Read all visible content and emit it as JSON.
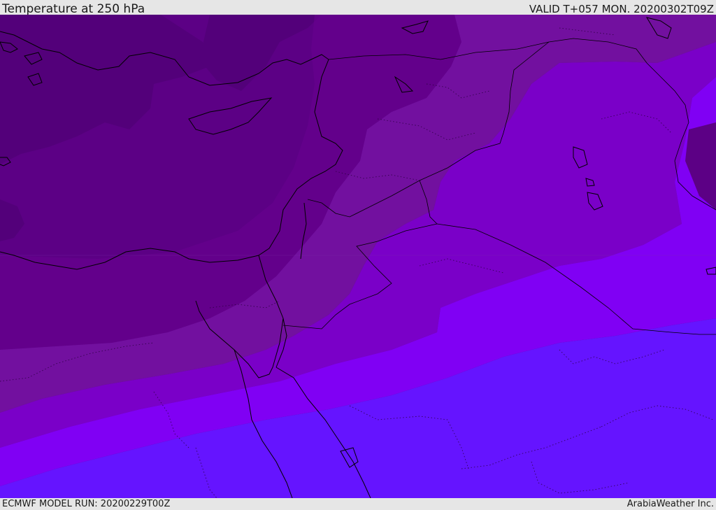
{
  "header": {
    "title": "Temperature at 250 hPa",
    "valid": "VALID T+057 MON. 20200302T09Z"
  },
  "footer": {
    "model_run": "ECMWF MODEL RUN: 20200229T00Z",
    "credit": "ArabiaWeather Inc."
  },
  "map": {
    "palette": {
      "coldest": "#53007a",
      "cold": "#5c0085",
      "mid_cold": "#67008f",
      "mid": "#72109f",
      "mid_warm": "#7a00c8",
      "warm": "#8000f4",
      "warmest": "#6514ff",
      "coastline": "#000000",
      "border": "#000000"
    }
  }
}
